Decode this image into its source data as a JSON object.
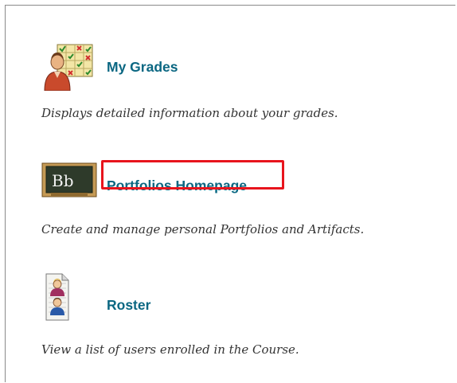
{
  "tools": {
    "grades": {
      "label": "My Grades",
      "description": "Displays detailed information about your grades.",
      "icon": "grades-icon"
    },
    "portfolios": {
      "label": "Portfolios Homepage",
      "description": "Create and manage personal Portfolios and Artifacts.",
      "icon": "blackboard-bb-icon",
      "highlight_color": "#e8141c"
    },
    "roster": {
      "label": "Roster",
      "description": "View a list of users enrolled in the Course.",
      "icon": "roster-icon"
    }
  },
  "colors": {
    "link": "#0b6782",
    "description": "#333333"
  }
}
